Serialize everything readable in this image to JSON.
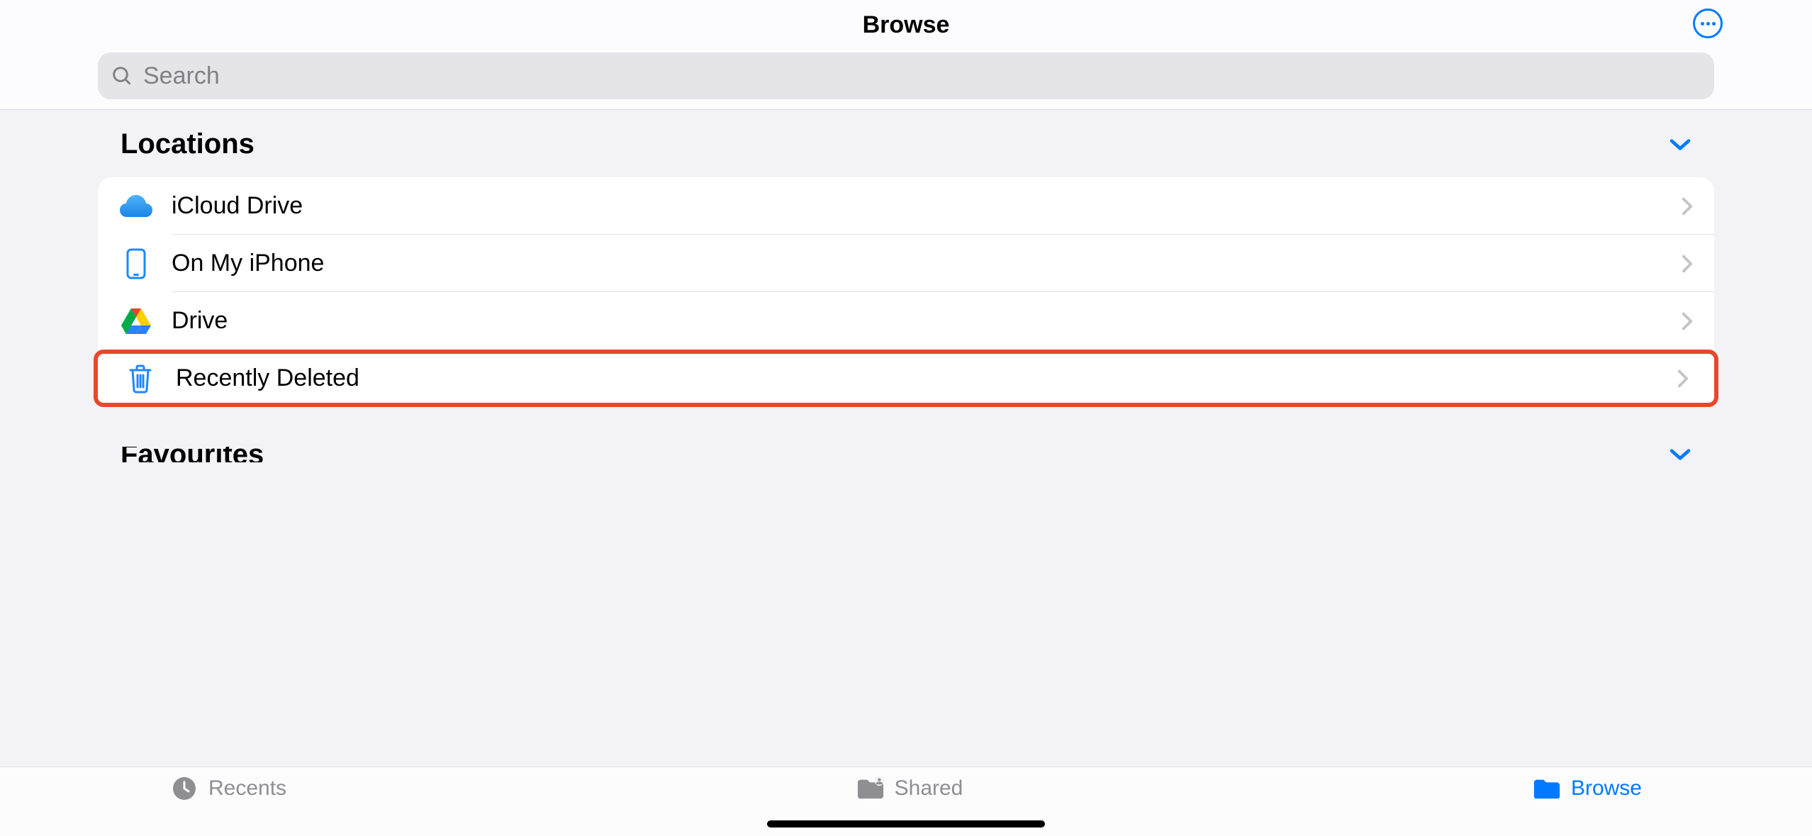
{
  "header": {
    "title": "Browse",
    "more_icon": "more-horizontal-icon"
  },
  "search": {
    "placeholder": "Search",
    "value": ""
  },
  "sections": {
    "locations": {
      "title": "Locations",
      "items": [
        {
          "icon": "icloud-icon",
          "label": "iCloud Drive"
        },
        {
          "icon": "iphone-icon",
          "label": "On My iPhone"
        },
        {
          "icon": "google-drive-icon",
          "label": "Drive"
        },
        {
          "icon": "trash-icon",
          "label": "Recently Deleted",
          "highlighted": true
        }
      ]
    },
    "favourites": {
      "title": "Favourites"
    }
  },
  "tabs": [
    {
      "icon": "clock-icon",
      "label": "Recents",
      "active": false
    },
    {
      "icon": "shared-folder-icon",
      "label": "Shared",
      "active": false
    },
    {
      "icon": "folder-icon",
      "label": "Browse",
      "active": true
    }
  ],
  "colors": {
    "accent": "#007aff",
    "highlight_border": "#e8472c",
    "inactive": "#8e8e93"
  }
}
